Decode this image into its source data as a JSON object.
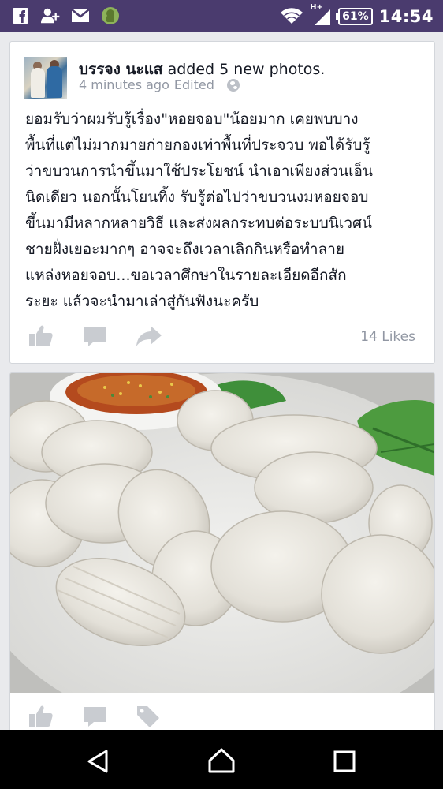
{
  "status_bar": {
    "notification_icons": [
      "facebook-icon",
      "friend-request-icon",
      "gmail-icon",
      "android-app-icon"
    ],
    "network_type": "H+",
    "battery": "61%",
    "time": "14:54"
  },
  "post": {
    "author": "บรรจง นะแส",
    "action": "added 5 new photos.",
    "timestamp": "4 minutes ago",
    "edited_label": "Edited",
    "privacy_icon": "globe-icon",
    "body_lines": [
      "ยอมรับว่าผมรับรู้เรื่อง\"หอยจอบ\"น้อยมาก เคยพบบาง",
      "พื้นที่แต่ไม่มากมายก่ายกองเท่าพื้นที่ประจวบ พอได้รับรู้",
      "ว่าขบวนการนำขึ้นมาใช้ประโยชน์ นำเอาเพียงส่วนเอ็น",
      "นิดเดียว นอกนั้นโยนทิ้ง รับรู้ต่อไปว่าขบวนงมหอยจอบ",
      "ขึ้นมามีหลากหลายวิธี และส่งผลกระทบต่อระบบนิเวศน์",
      "ชายฝั่งเยอะมากๆ อาจจะถึงเวลาเลิกกินหรือทำลาย",
      "แหล่งหอยจอบ...ขอเวลาศึกษาในรายละเอียดอีกสัก",
      "ระยะ แล้วจะนำมาเล่าสู่กันฟังนะครับ"
    ],
    "likes": "14 Likes",
    "action_icons": [
      "like-icon",
      "comment-icon",
      "share-icon"
    ]
  },
  "photo_post": {
    "description": "photo",
    "action_icons": [
      "like-icon",
      "comment-icon",
      "tag-icon"
    ]
  },
  "nav": [
    "back-icon",
    "home-icon",
    "recents-icon"
  ],
  "colors": {
    "status_bar": "#4a3b6e",
    "background": "#e9eaed",
    "icon_gray": "#c9ccd1",
    "meta_gray": "#9197a3"
  }
}
